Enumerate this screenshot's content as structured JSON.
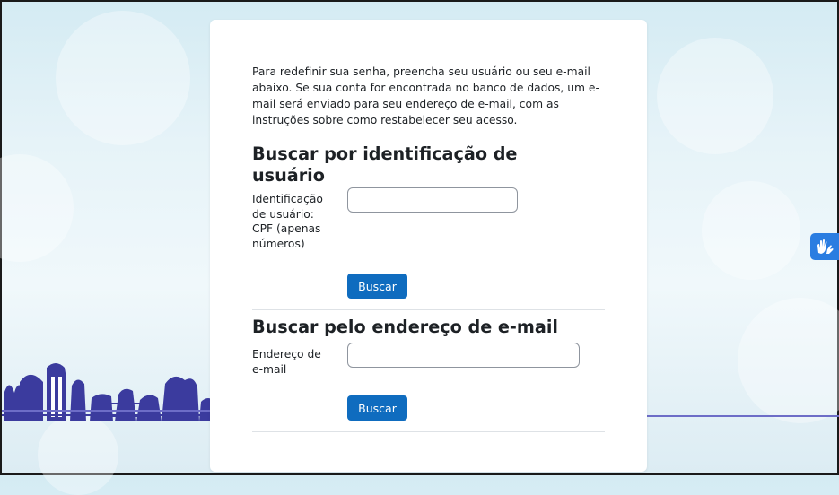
{
  "reset_form": {
    "intro_text": "Para redefinir sua senha, preencha seu usuário ou seu e-mail abaixo. Se sua conta for encontrada no banco de dados, um e-mail será enviado para seu endereço de e-mail, com as instruções sobre como restabelecer seu acesso.",
    "username_section": {
      "heading_line1": "Buscar por identificação de",
      "heading_line2": "usuário",
      "field_label_lines": [
        "Identificação",
        "de usuário:",
        "CPF (apenas",
        "números)"
      ],
      "field_value": "",
      "button_label": "Buscar"
    },
    "email_section": {
      "heading": "Buscar pelo endereço de e-mail",
      "field_label_lines": [
        "Endereço de",
        "e-mail"
      ],
      "field_value": "",
      "button_label": "Buscar"
    }
  },
  "accessibility_widget": {
    "icon": "sign-language-hands-icon",
    "color": "#2a7de1"
  },
  "colors": {
    "primary_button": "#0f6cbf",
    "page_background": "#e6f3f8",
    "skyline": "#3b3b9e"
  }
}
